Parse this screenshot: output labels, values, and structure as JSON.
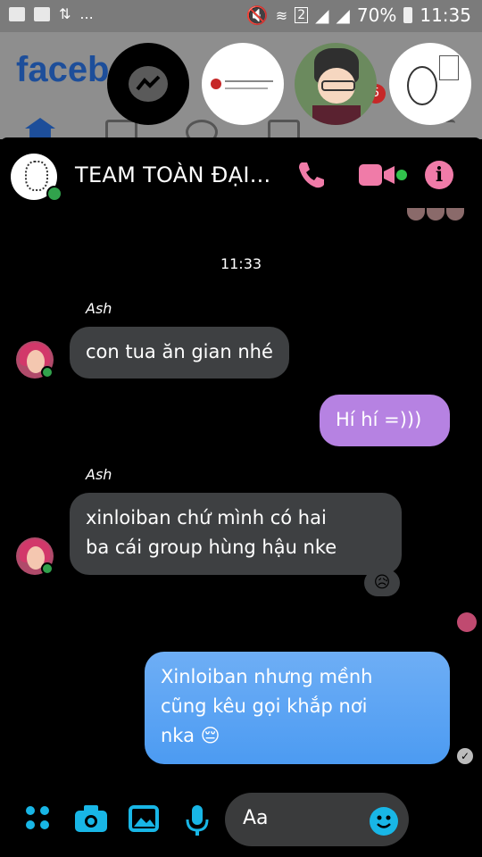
{
  "status_bar": {
    "battery": "70%",
    "time": "11:35",
    "sim": "2",
    "overflow": "..."
  },
  "background": {
    "logo": "faceb",
    "notif_count": "5"
  },
  "chat_heads": [
    "messenger-icon",
    "shared-post",
    "anime-avatar",
    "sketch-avatar"
  ],
  "chat": {
    "title": "TEAM TOÀN ĐẠI...",
    "timestamp": "11:33",
    "messages": [
      {
        "sender": "Ash",
        "text": "con tua ăn gian nhé",
        "direction": "in"
      },
      {
        "text": "Hí hí =)))",
        "direction": "out"
      },
      {
        "sender": "Ash",
        "text_lines": [
          "xinloiban chứ mình có hai",
          "ba cái group hùng hậu nke"
        ],
        "direction": "in",
        "reaction": "😥"
      },
      {
        "text_lines": [
          "Xinloiban nhưng mềnh",
          "cũng kêu gọi khắp nơi",
          "nka 😔"
        ],
        "direction": "out"
      }
    ]
  },
  "composer": {
    "placeholder": "Aa",
    "quick_reaction": "😂"
  },
  "colors": {
    "accent_pink": "#f07ba8",
    "bubble_out_purple": "#b682e2",
    "bubble_out_blue": "#62a8f5",
    "bubble_in": "#3e4042",
    "icon_blue": "#18b6e6"
  }
}
